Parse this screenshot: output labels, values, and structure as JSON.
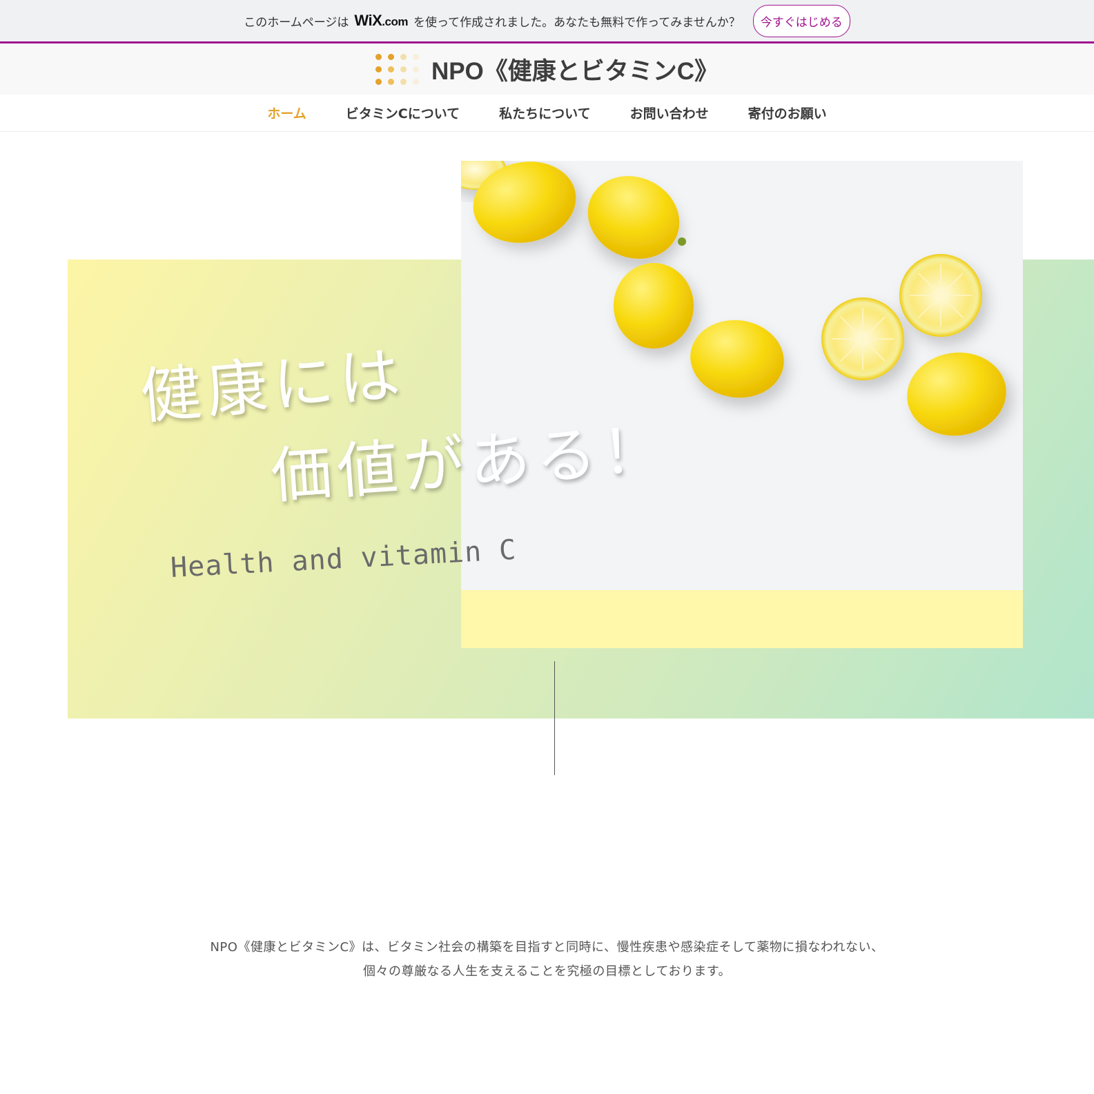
{
  "wix_banner": {
    "text_before": "このホームページは",
    "logo_wix": "WiX",
    "logo_dotcom": ".com",
    "text_after": "を使って作成されました。あなたも無料で作ってみませんか？",
    "cta_label": "今すぐはじめる",
    "accent_color": "#a0138e"
  },
  "header": {
    "title": "NPO《健康とビタミンC》",
    "logo_dot_colors": [
      "#e3a22c",
      "#efbf5a",
      "#f5e0b0",
      "#f7efdc"
    ]
  },
  "nav": {
    "items": [
      {
        "label": "ホーム",
        "active": true
      },
      {
        "label": "ビタミンCについて",
        "active": false
      },
      {
        "label": "私たちについて",
        "active": false
      },
      {
        "label": "お問い合わせ",
        "active": false
      },
      {
        "label": "寄付のお願い",
        "active": false
      }
    ],
    "active_color": "#e3a22c"
  },
  "hero": {
    "heading_line1": "健康には",
    "heading_line2": "価値がある！",
    "subheading": "Health and vitamin C",
    "image_subject": "lemons"
  },
  "mission": {
    "line1": "NPO《健康とビタミンC》は、ビタミン社会の構築を目指すと同時に、慢性疾患や感染症そして薬物に損なわれない、",
    "line2": "個々の尊厳なる人生を支えることを究極の目標としております。"
  }
}
